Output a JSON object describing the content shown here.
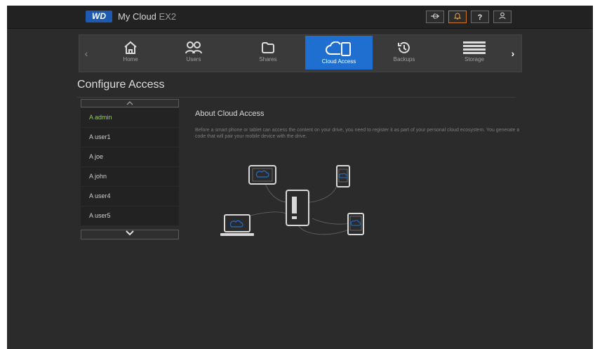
{
  "app": {
    "logo": "WD",
    "product_name": "My Cloud",
    "product_model": "EX2"
  },
  "toolbar": {
    "usb_icon": "usb-icon",
    "alert_icon": "bell-icon",
    "help_label": "?",
    "user_icon": "user-icon"
  },
  "nav": {
    "items": [
      {
        "label": "Home",
        "icon": "home-icon"
      },
      {
        "label": "Users",
        "icon": "users-icon"
      },
      {
        "label": "Shares",
        "icon": "folder-icon"
      },
      {
        "label": "Cloud Access",
        "icon": "cloud-device-icon",
        "active": true
      },
      {
        "label": "Backups",
        "icon": "history-icon"
      },
      {
        "label": "Storage",
        "icon": "storage-icon"
      }
    ]
  },
  "page": {
    "title": "Configure Access"
  },
  "users": [
    {
      "name": "admin",
      "selected": true
    },
    {
      "name": "user1"
    },
    {
      "name": "joe"
    },
    {
      "name": "john"
    },
    {
      "name": "user4"
    },
    {
      "name": "user5"
    }
  ],
  "about": {
    "title": "About Cloud Access",
    "text": "Before a smart phone or tablet can access the content on your drive, you need to register it as part of your personal cloud ecosystem. You generate a code that will pair your mobile device with the drive."
  },
  "colors": {
    "accent": "#1f6fd1",
    "selected_user": "#8fd34e",
    "alert": "#d0761c"
  }
}
